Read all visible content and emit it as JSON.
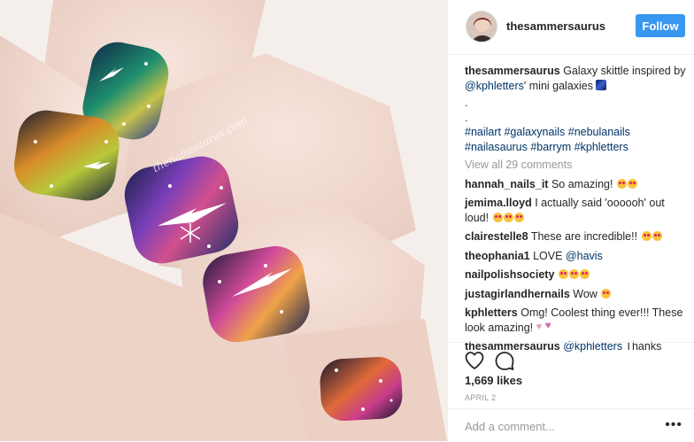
{
  "photo": {
    "watermark": "thenailasaurus.com"
  },
  "post": {
    "username": "thesammersaurus",
    "follow_label": "Follow",
    "caption": {
      "user": "thesammersaurus",
      "text_1": "Galaxy skittle inspired by ",
      "mention": "@kphletters",
      "text_2": "' mini galaxies ",
      "dot1": ".",
      "dot2": ".",
      "hashtags": "#nailart #galaxynails #nebulanails #nailasaurus #barrym #kphletters"
    },
    "view_all": "View all 29 comments",
    "comments": [
      {
        "user": "hannah_nails_it",
        "text": " So amazing! "
      },
      {
        "user": "jemima.lloyd",
        "text": " I actually said 'oooooh' out loud! "
      },
      {
        "user": "clairestelle8",
        "text": " These are incredible!! "
      },
      {
        "user": "theophania1",
        "text": " LOVE ",
        "mention": "@havis"
      },
      {
        "user": "nailpolishsociety",
        "text": " "
      },
      {
        "user": "justagirlandhernails",
        "text": " Wow "
      },
      {
        "user": "kphletters",
        "text": " Omg! Coolest thing ever!!! These look amazing! "
      },
      {
        "user": "thesammersaurus",
        "mention": "@kphletters",
        "text": " Thanks"
      }
    ],
    "likes": "1,669 likes",
    "date": "APRIL 2",
    "add_comment_placeholder": "Add a comment...",
    "more_label": "•••",
    "icons": {
      "like": "heart-outline-icon",
      "comment": "comment-bubble-icon"
    },
    "colors": {
      "follow": "#3897f0",
      "link": "#003569",
      "muted": "#999999"
    }
  }
}
